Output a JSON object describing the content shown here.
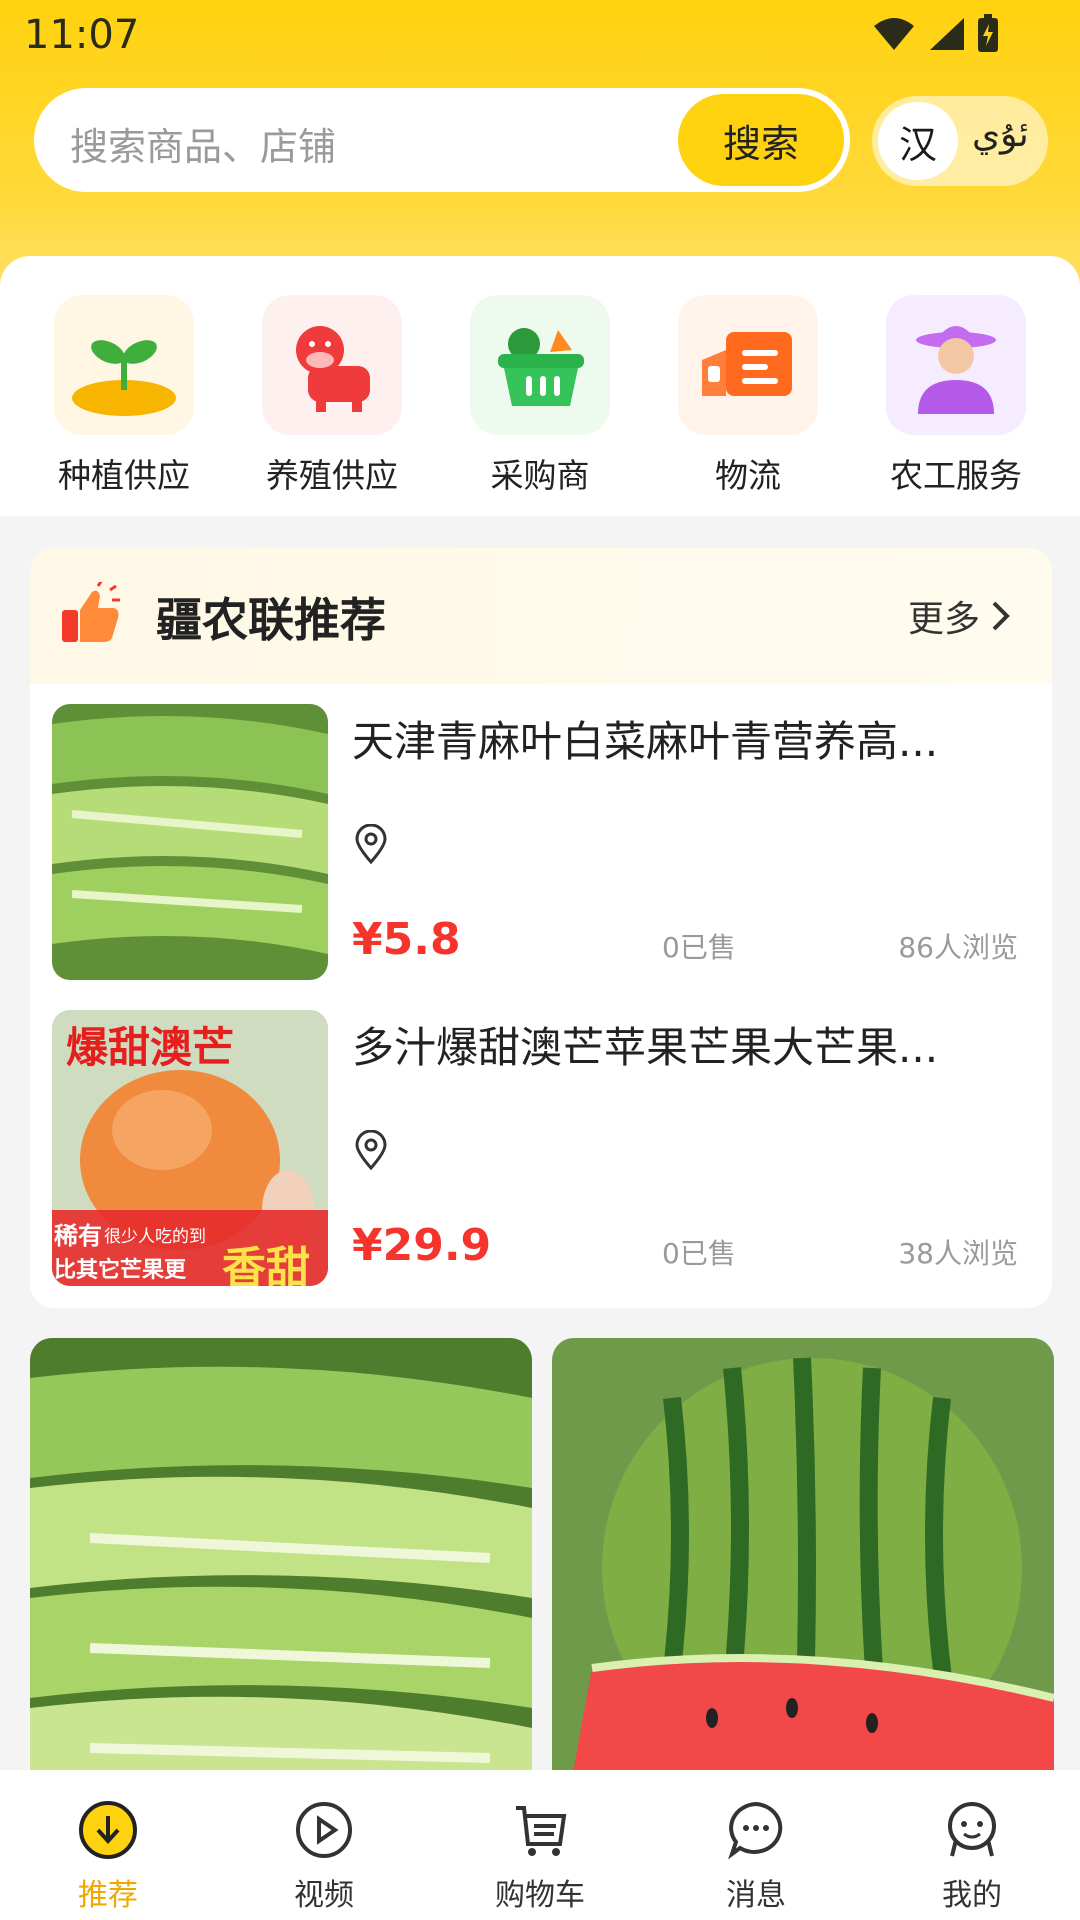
{
  "status_bar": {
    "time": "11:07"
  },
  "search": {
    "placeholder": "搜索商品、店铺",
    "button_label": "搜索"
  },
  "language_toggle": {
    "chinese": "汉",
    "uyghur": "ئۇي"
  },
  "categories": [
    {
      "label": "种植供应",
      "icon": "sprout-icon"
    },
    {
      "label": "养殖供应",
      "icon": "cow-icon"
    },
    {
      "label": "采购商",
      "icon": "basket-icon"
    },
    {
      "label": "物流",
      "icon": "truck-icon"
    },
    {
      "label": "农工服务",
      "icon": "farmer-icon"
    }
  ],
  "recommend": {
    "title": "疆农联推荐",
    "more_label": "更多",
    "items": [
      {
        "name": "天津青麻叶白菜麻叶青营养高...",
        "price": "¥5.8",
        "sold": "0已售",
        "views": "86人浏览"
      },
      {
        "name": "多汁爆甜澳芒苹果芒果大芒果...",
        "price": "¥29.9",
        "sold": "0已售",
        "views": "38人浏览",
        "image_text": {
          "top": "爆甜澳芒",
          "rare": "稀有",
          "few": "很少人吃的到",
          "compare": "比其它芒果更",
          "sweet": "香甜"
        }
      }
    ]
  },
  "tab_bar": [
    {
      "label": "推荐",
      "icon": "download-circle-icon",
      "active": true
    },
    {
      "label": "视频",
      "icon": "play-icon",
      "active": false
    },
    {
      "label": "购物车",
      "icon": "cart-icon",
      "active": false
    },
    {
      "label": "消息",
      "icon": "message-icon",
      "active": false
    },
    {
      "label": "我的",
      "icon": "profile-icon",
      "active": false
    }
  ],
  "colors": {
    "accent": "#ffd20f",
    "price": "#f5352d",
    "active_tab": "#f0a800"
  }
}
